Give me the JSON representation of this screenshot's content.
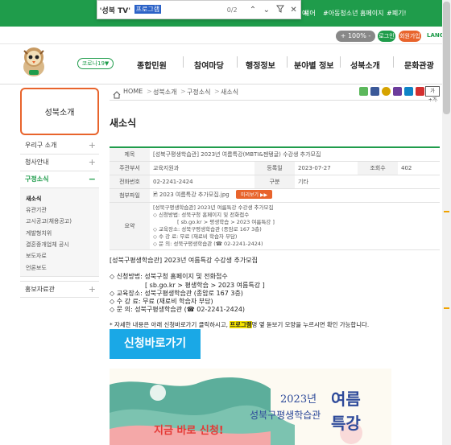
{
  "top_bar": {
    "keywords": [
      "예",
      "셔어",
      "#아동청소년 홈페이지",
      "#폐기!"
    ]
  },
  "find_bar": {
    "title": "'성북 TV'",
    "query": "프로그램",
    "count": "0/2"
  },
  "utility": {
    "zoom": "+ 100% -",
    "login": "로그인",
    "join": "회원가입",
    "language": "LANGU"
  },
  "header": {
    "covid_label": "코로나19▼",
    "gnb": [
      "종합민원",
      "참여마당",
      "행정정보",
      "분야별 정보",
      "성북소개",
      "문화관광"
    ]
  },
  "sidebar": {
    "title": "성북소개",
    "items": [
      {
        "label": "우리구 소개",
        "pm": "+"
      },
      {
        "label": "청사안내",
        "pm": "+"
      },
      {
        "label": "구정소식",
        "pm": "−"
      }
    ],
    "sub_items": [
      "새소식",
      "유관기관",
      "고시공고(채용공고)",
      "계발형치위",
      "결혼중개업체 공시",
      "보도자료",
      "언론보도"
    ],
    "bottom_item": {
      "label": "홍보자료관",
      "pm": "+"
    }
  },
  "breadcrumb": [
    "HOME",
    "성북소개",
    "구정소식",
    "새소식"
  ],
  "page_title": "새소식",
  "info": {
    "labels": {
      "title": "제목",
      "dept": "주관부서",
      "reg_date": "등록일",
      "views": "조회수",
      "phone": "전화번호",
      "category": "구분",
      "attachment": "첨부파일",
      "summary": "요약"
    },
    "title": "[성북구평생학습관] 2023년 여름특강(MBTI&젠탱글) 수강생 추가모집",
    "dept": "교육지원과",
    "reg_date": "2023-07-27",
    "views": "402",
    "phone": "02-2241-2424",
    "category": "기타",
    "attachment": "2023 여름특강 추가모집.jpg",
    "preview_btn": "미리보기 ▶▶",
    "summary": [
      "[성북구평생학습관] 2023년 여름특강 수강생 추가모집",
      "◇ 신청방법: 성북구청 홈페이지 및 전화접수",
      "[ sb.go.kr > 평생학습 > 2023 여름특강 ]",
      "◇ 교육장소: 성북구평생학습관 (종암로 167 3층)",
      "◇ 수 강 료: 무료 (재료비 학습자 부담)",
      "◇ 문 의: 성북구평생학습관 (☎ 02-2241-2424)"
    ]
  },
  "body": {
    "heading": "[성북구평생학습관] 2023년 여름특강 수강생 추가모집",
    "l1": "◇ 신청방법: 성북구청 홈페이지 및 전화접수",
    "l2": "[ sb.go.kr > 평생학습 > 2023 여름특강 ]",
    "l3": "◇ 교육장소: 성북구평생학습관 (종암로 167 3층)",
    "l4": "◇ 수 강 료: 무료 (재료비 학습자 부담)",
    "l5": "◇ 문 의: 성북구평생학습관 (☎ 02-2241-2424)",
    "note_pre": "* 자세한 내용은 아래 신청바로가기 클릭하시고, ",
    "note_hl": "프로그램",
    "note_post": "명 옆 돋보기 모양을 누르시면 확인 가능합니다.",
    "apply_btn": "신청바로가기"
  },
  "poster": {
    "year": "2023년",
    "org": "성북구평생학습관",
    "big1": "여름",
    "big2": "특강",
    "cta": "지금 바로 신청!"
  },
  "colors": {
    "brand_green": "#1f9c4b",
    "accent_orange": "#e8642c",
    "apply_blue": "#1aa8e6",
    "highlight_yellow": "#f6e400"
  }
}
